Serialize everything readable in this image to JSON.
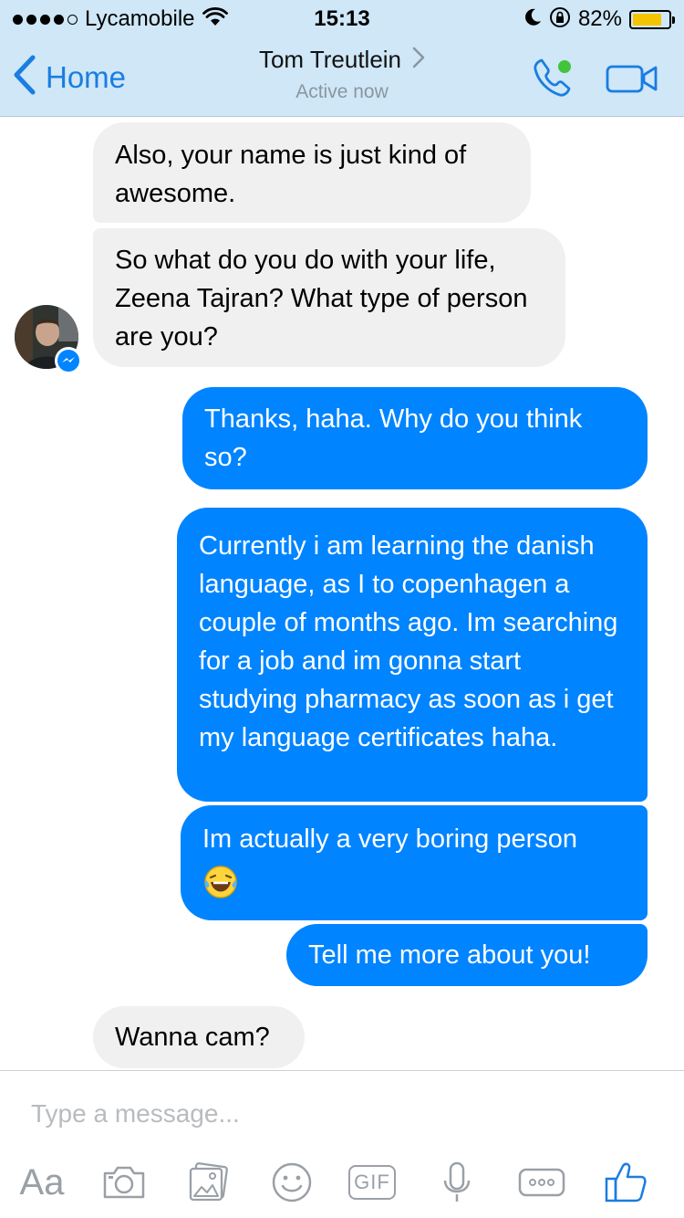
{
  "status_bar": {
    "carrier": "Lycamobile",
    "time": "15:13",
    "battery_percent": "82%",
    "battery_level": 0.82,
    "signal_bars_filled": 4,
    "signal_bars_total": 5
  },
  "nav": {
    "back_label": "Home",
    "contact_name": "Tom Treutlein",
    "status": "Active now",
    "accent_color": "#1a7de1",
    "online_color": "#42c43c"
  },
  "messages": [
    {
      "direction": "incoming",
      "text": "Also, your name is just kind of awesome."
    },
    {
      "direction": "incoming",
      "text": "So what do you do with your life, Zeena Tajran? What type of person are you?"
    },
    {
      "direction": "outgoing",
      "text": "Thanks, haha. Why do you think so?"
    },
    {
      "direction": "outgoing",
      "text": "Currently i am learning the danish language, as I to copenhagen a couple of months ago. Im searching for a job and im gonna start studying pharmacy as soon as i get my language certificates haha."
    },
    {
      "direction": "outgoing",
      "text": "Im actually a very boring person",
      "emoji": "face-with-tears-of-joy"
    },
    {
      "direction": "outgoing",
      "text": "Tell me more about you!"
    },
    {
      "direction": "incoming",
      "text": "Wanna cam?"
    }
  ],
  "composer": {
    "placeholder": "Type a message...",
    "aa_label": "Aa",
    "gif_label": "GIF",
    "icons": [
      "aa-icon",
      "camera-icon",
      "gallery-icon",
      "sticker-icon",
      "gif-icon",
      "microphone-icon",
      "more-icon",
      "like-icon"
    ]
  },
  "colors": {
    "outgoing_bubble": "#0084ff",
    "incoming_bubble": "#f1f0f0",
    "header_background": "#cfe7f7",
    "battery_fill": "#f5c400"
  }
}
